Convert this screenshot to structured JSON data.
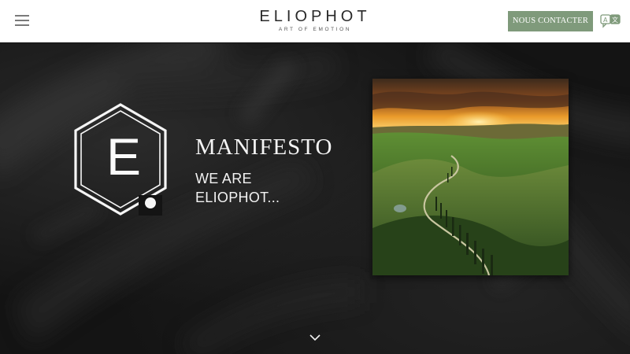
{
  "header": {
    "menu_icon": "hamburger-menu-icon",
    "logo": {
      "title": "ELIOPHOT",
      "tagline": "ART OF EMOTION"
    },
    "contact_button": "NOUS CONTACTER",
    "language_icon": "chat-language-icon",
    "accent_color": "#7f9a7b"
  },
  "hero": {
    "emblem_letter": "E",
    "title": "MANIFESTO",
    "subtitle_line1": "WE ARE",
    "subtitle_line2": "ELIOPHOT...",
    "photo_subject": "landscape-photo",
    "scroll_icon": "chevron-down-icon"
  }
}
